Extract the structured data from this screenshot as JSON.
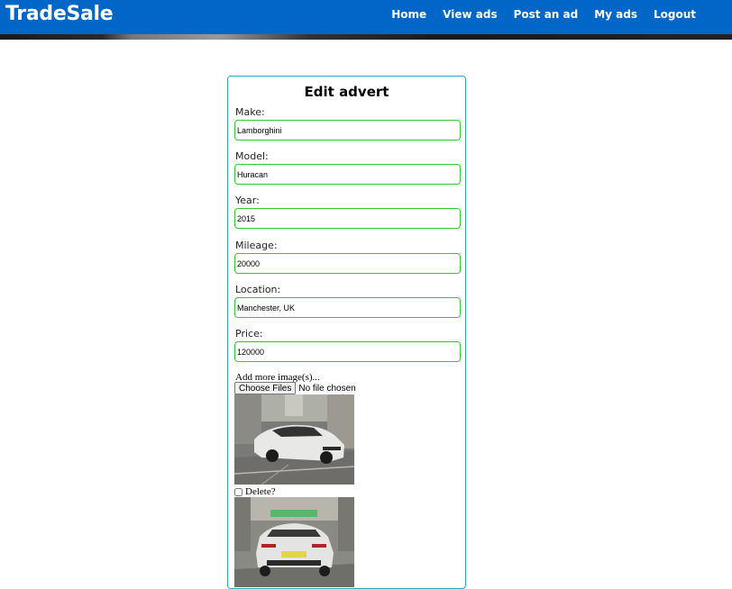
{
  "navbar": {
    "brand": "TradeSale",
    "links": [
      {
        "label": "Home"
      },
      {
        "label": "View ads"
      },
      {
        "label": "Post an ad"
      },
      {
        "label": "My ads"
      },
      {
        "label": "Logout"
      }
    ],
    "color": "#0066c7"
  },
  "form": {
    "title": "Edit advert",
    "fields": [
      {
        "label": "Make:",
        "value": "Lamborghini"
      },
      {
        "label": "Model:",
        "value": "Huracan"
      },
      {
        "label": "Year:",
        "value": "2015"
      },
      {
        "label": "Mileage:",
        "value": "20000"
      },
      {
        "label": "Location:",
        "value": "Manchester, UK"
      },
      {
        "label": "Price:",
        "value": "120000"
      }
    ],
    "add_images_label": "Add more image(s)...",
    "file_button": "Choose Files",
    "file_status": "No file chosen",
    "delete_label": "Delete?"
  },
  "colors": {
    "input_border": "#2ecc2e",
    "panel_border": "#29a7c4"
  }
}
